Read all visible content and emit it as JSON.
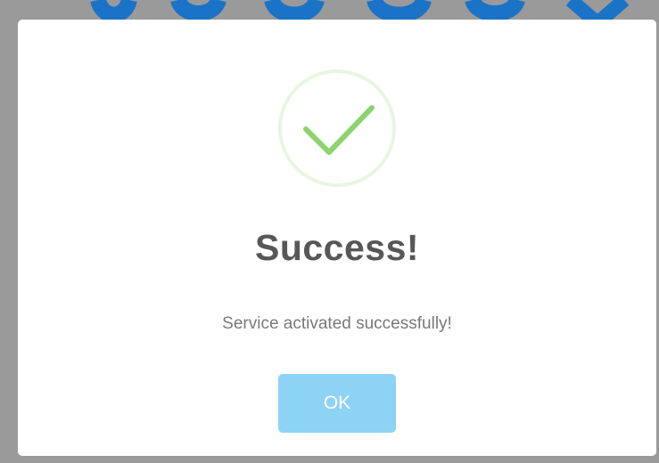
{
  "dialog": {
    "title": "Success!",
    "message": "Service activated successfully!",
    "ok_label": "OK",
    "icon": "checkmark-icon"
  },
  "colors": {
    "backdrop": "#9a9a9a",
    "check": "#8dd36e",
    "check_ring": "#e8f5e0",
    "button": "#8dd3f5",
    "title": "#575757",
    "message": "#797979"
  }
}
